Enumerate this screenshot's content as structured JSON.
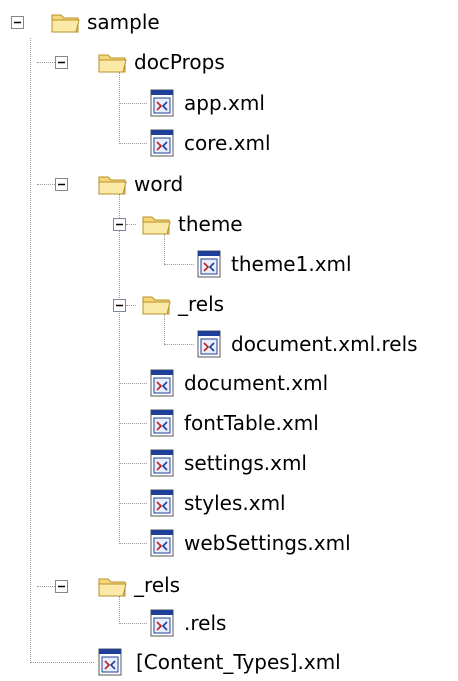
{
  "tree": {
    "root": {
      "label": "sample",
      "expanded": true,
      "children": [
        {
          "label": "docProps",
          "type": "folder",
          "expanded": true,
          "children": [
            {
              "label": "app.xml",
              "type": "file"
            },
            {
              "label": "core.xml",
              "type": "file"
            }
          ]
        },
        {
          "label": "word",
          "type": "folder",
          "expanded": true,
          "children": [
            {
              "label": "theme",
              "type": "folder",
              "expanded": true,
              "children": [
                {
                  "label": "theme1.xml",
                  "type": "file"
                }
              ]
            },
            {
              "label": "_rels",
              "type": "folder",
              "expanded": true,
              "children": [
                {
                  "label": "document.xml.rels",
                  "type": "file"
                }
              ]
            },
            {
              "label": "document.xml",
              "type": "file"
            },
            {
              "label": "fontTable.xml",
              "type": "file"
            },
            {
              "label": "settings.xml",
              "type": "file"
            },
            {
              "label": "styles.xml",
              "type": "file"
            },
            {
              "label": "webSettings.xml",
              "type": "file"
            }
          ]
        },
        {
          "label": "_rels",
          "type": "folder",
          "expanded": true,
          "children": [
            {
              "label": ".rels",
              "type": "file"
            }
          ]
        },
        {
          "label": "[Content_Types].xml",
          "type": "file"
        }
      ]
    }
  },
  "icons": {
    "folder": "folder-open-icon",
    "file": "xml-file-icon",
    "toggle": "collapse-minus-icon"
  },
  "colors": {
    "folder_fill": "#f5d77a",
    "folder_stroke": "#b8902a",
    "file_blue": "#1f3f99",
    "file_red": "#c02020",
    "connector": "#9a9a9a"
  }
}
